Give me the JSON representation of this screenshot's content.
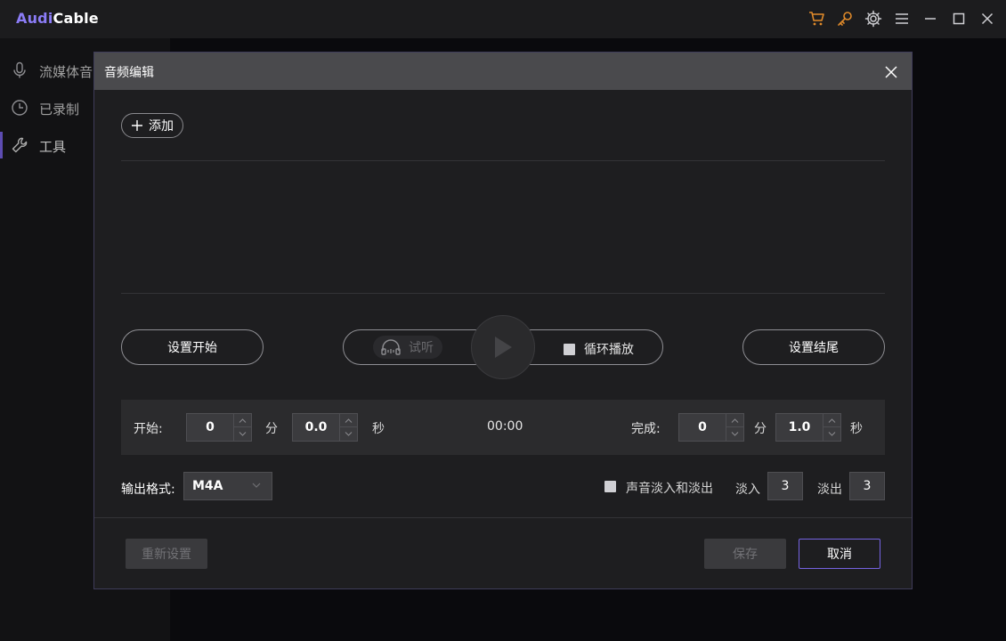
{
  "app": {
    "logo_part1": "Audi",
    "logo_part2": "Cable",
    "accent_color": "#7c66ee",
    "titlebar_icons": [
      "cart-icon",
      "key-icon",
      "gear-icon",
      "menu-icon",
      "minimize-icon",
      "maximize-icon",
      "close-icon"
    ]
  },
  "sidebar": {
    "items": [
      {
        "label": "流媒体音",
        "icon": "microphone-icon",
        "active": false
      },
      {
        "label": "已录制",
        "icon": "clock-icon",
        "active": false
      },
      {
        "label": "工具",
        "icon": "wrench-icon",
        "active": true
      }
    ]
  },
  "dialog": {
    "title": "音频编辑",
    "add_label": "添加",
    "set_start_label": "设置开始",
    "set_end_label": "设置结尾",
    "listen_label": "试听",
    "loop_label": "循环播放",
    "loop_checked": false,
    "time": {
      "start_label": "开始:",
      "start_min": "0",
      "start_sec": "0.0",
      "min_unit": "分",
      "sec_unit": "秒",
      "current": "00:00",
      "end_label": "完成:",
      "end_min": "0",
      "end_sec": "1.0"
    },
    "output": {
      "label": "输出格式:",
      "format": "M4A"
    },
    "fade": {
      "checkbox_label": "声音淡入和淡出",
      "checked": false,
      "fade_in_label": "淡入",
      "fade_in_value": "3",
      "fade_out_label": "淡出",
      "fade_out_value": "3"
    },
    "reset_label": "重新设置",
    "save_label": "保存",
    "cancel_label": "取消"
  }
}
